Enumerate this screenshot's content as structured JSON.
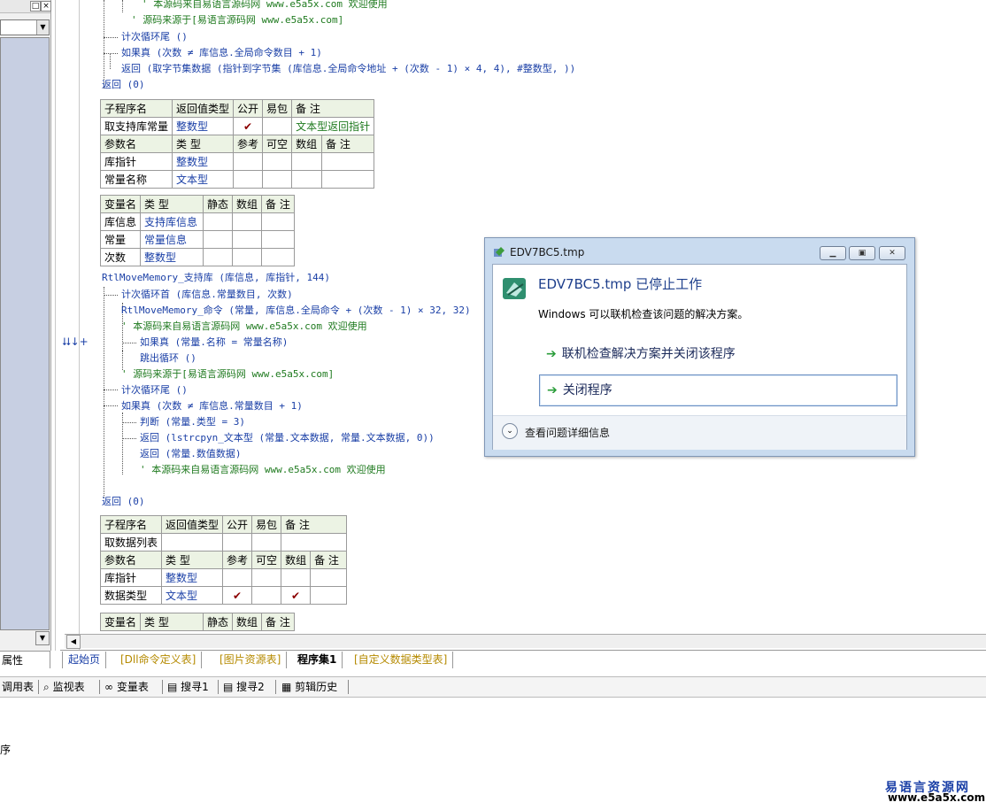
{
  "code_top": [
    {
      "text": "' 本源码来自易语言源码网 www.e5a5x.com  欢迎使用",
      "cls": "cm"
    },
    {
      "text": "' 源码来源于[易语言源码网 www.e5a5x.com]",
      "cls": "cm"
    },
    {
      "text": "计次循环尾 ()",
      "cls": "kw"
    },
    {
      "text": "如果真 (次数 ≠ 库信息.全局命令数目 + 1)",
      "cls": "kw"
    },
    {
      "text": "返回 (取字节集数据 (指针到字节集 (库信息.全局命令地址 + (次数 - 1) × 4, 4), #整数型, ))",
      "cls": "kw"
    },
    {
      "text": "返回 (0)",
      "cls": "kw"
    }
  ],
  "table1": {
    "hdr1": [
      "子程序名",
      "返回值类型",
      "公开",
      "易包",
      "备 注"
    ],
    "row1": [
      "取支持库常量",
      "整数型",
      "✔",
      "",
      "文本型返回指针"
    ],
    "hdr2": [
      "参数名",
      "类 型",
      "参考",
      "可空",
      "数组",
      "备 注"
    ],
    "params": [
      [
        "库指针",
        "整数型"
      ],
      [
        "常量名称",
        "文本型"
      ]
    ]
  },
  "table2": {
    "hdr": [
      "变量名",
      "类 型",
      "静态",
      "数组",
      "备 注"
    ],
    "rows": [
      [
        "库信息",
        "支持库信息"
      ],
      [
        "常量",
        "常量信息"
      ],
      [
        "次数",
        "整数型"
      ]
    ]
  },
  "code_mid": [
    {
      "text": "RtlMoveMemory_支持库 (库信息, 库指针, 144)",
      "cls": "kw"
    },
    {
      "text": "计次循环首 (库信息.常量数目, 次数)",
      "cls": "kw"
    },
    {
      "text": "RtlMoveMemory_命令 (常量, 库信息.全局命令 + (次数 - 1) × 32, 32)",
      "cls": "kw"
    },
    {
      "text": "' 本源码来自易语言源码网 www.e5a5x.com  欢迎使用",
      "cls": "cm"
    },
    {
      "text": "如果真 (常量.名称 = 常量名称)",
      "cls": "kw"
    },
    {
      "text": "跳出循环 ()",
      "cls": "kw"
    },
    {
      "text": "' 源码来源于[易语言源码网 www.e5a5x.com]",
      "cls": "cm"
    },
    {
      "text": "计次循环尾 ()",
      "cls": "kw"
    },
    {
      "text": "如果真 (次数 ≠ 库信息.常量数目 + 1)",
      "cls": "kw"
    },
    {
      "text": "判断 (常量.类型 = 3)",
      "cls": "kw"
    },
    {
      "text": "返回 (lstrcpyn_文本型 (常量.文本数据, 常量.文本数据, 0))",
      "cls": "kw"
    },
    {
      "text": "返回 (常量.数值数据)",
      "cls": "kw"
    },
    {
      "text": "' 本源码来自易语言源码网 www.e5a5x.com  欢迎使用",
      "cls": "cm"
    },
    {
      "text": "返回 (0)",
      "cls": "kw"
    }
  ],
  "table3": {
    "hdr1": [
      "子程序名",
      "返回值类型",
      "公开",
      "易包",
      "备 注"
    ],
    "row1": [
      "取数据列表",
      "",
      "",
      "",
      ""
    ],
    "hdr2": [
      "参数名",
      "类 型",
      "参考",
      "可空",
      "数组",
      "备 注"
    ],
    "params": [
      [
        "库指针",
        "整数型",
        "",
        "",
        "",
        ""
      ],
      [
        "数据类型",
        "文本型",
        "✔",
        "",
        "✔",
        ""
      ]
    ]
  },
  "table4": {
    "hdr": [
      "变量名",
      "类 型",
      "静态",
      "数组",
      "备 注"
    ]
  },
  "left": {
    "props_tab": "属性",
    "ctrl_glyph": "□",
    "close_glyph": "×"
  },
  "gutter_mark": "⮇↓+",
  "file_tabs": [
    "起始页",
    "[Dll命令定义表]",
    "[图片资源表]",
    "程序集1",
    "[自定义数据类型表]"
  ],
  "toolbar": [
    {
      "icon": "search-icon",
      "label": "调用表"
    },
    {
      "icon": "monitor-icon",
      "label": "监视表"
    },
    {
      "icon": "variable-icon",
      "label": "变量表"
    },
    {
      "icon": "find-icon",
      "label": "搜寻1"
    },
    {
      "icon": "find-icon",
      "label": "搜寻2"
    },
    {
      "icon": "clipboard-icon",
      "label": "剪辑历史"
    }
  ],
  "output": {
    "text": "序"
  },
  "dialog": {
    "title": "EDV7BC5.tmp",
    "heading": "EDV7BC5.tmp 已停止工作",
    "description": "Windows 可以联机检查该问题的解决方案。",
    "option1": "联机检查解决方案并关闭该程序",
    "option2": "关闭程序",
    "details": "查看问题详细信息"
  },
  "watermark": {
    "line1": "易语言资源网",
    "line2": "www.e5a5x.com"
  }
}
